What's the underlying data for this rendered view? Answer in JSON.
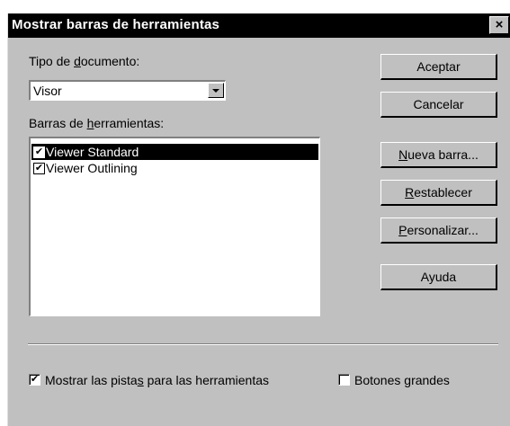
{
  "dialog": {
    "title": "Mostrar barras de herramientas",
    "close_glyph": "×"
  },
  "document_type": {
    "label_pre": "Tipo de ",
    "label_accel": "d",
    "label_post": "ocumento:",
    "selected_value": "Visor"
  },
  "toolbars": {
    "label_pre": "Barras de ",
    "label_accel": "h",
    "label_post": "erramientas:",
    "items": [
      {
        "label": "Viewer Standard",
        "checked": true,
        "selected": true
      },
      {
        "label": "Viewer Outlining",
        "checked": true,
        "selected": false
      }
    ]
  },
  "buttons": {
    "accept": "Aceptar",
    "cancel": "Cancelar",
    "new_accel": "N",
    "new_rest": "ueva barra...",
    "reset_accel": "R",
    "reset_rest": "establecer",
    "customize_accel": "P",
    "customize_rest": "ersonalizar...",
    "help": "Ayuda"
  },
  "options": {
    "tooltips_pre": "Mostrar las pista",
    "tooltips_accel": "s",
    "tooltips_post": " para las herramientas",
    "tooltips_checked": true,
    "large_pre": "Botones ",
    "large_accel": "g",
    "large_post": "randes",
    "large_checked": false
  },
  "check_glyph": "✔"
}
